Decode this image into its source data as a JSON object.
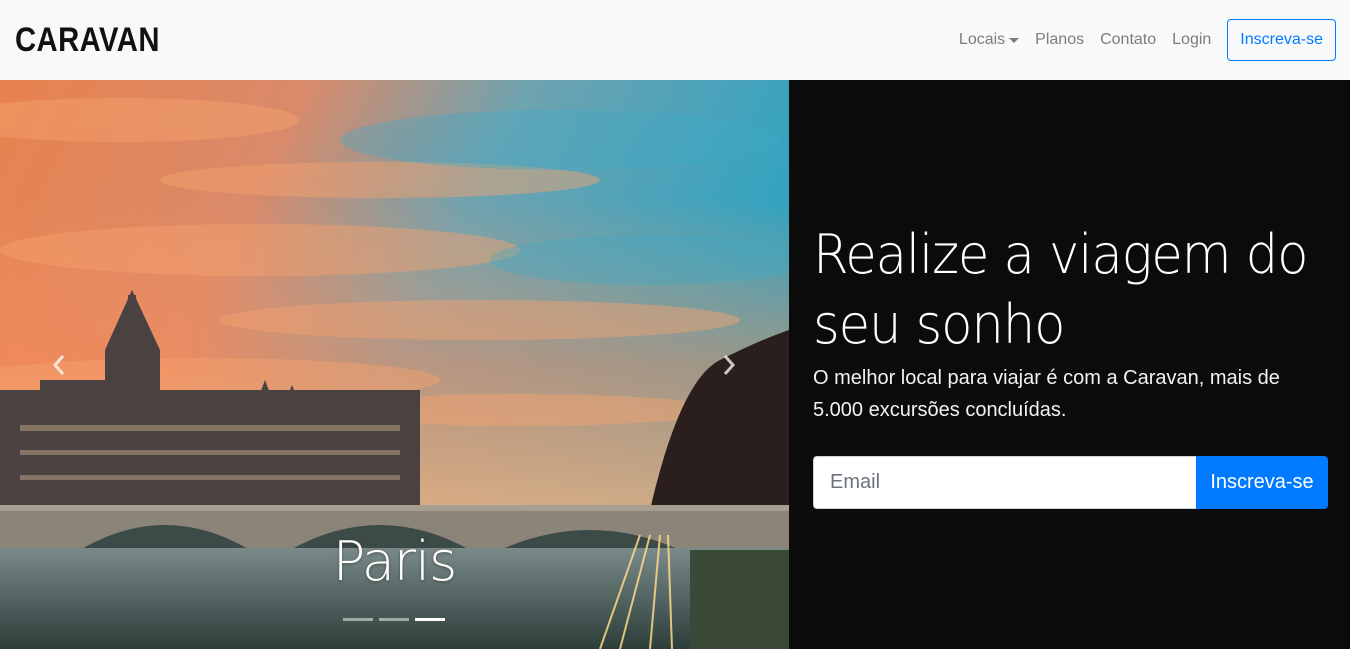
{
  "navbar": {
    "brand": "CARAVAN",
    "links": {
      "locais": "Locais",
      "planos": "Planos",
      "contato": "Contato",
      "login": "Login"
    },
    "signup_label": "Inscreva-se"
  },
  "carousel": {
    "caption": "Paris",
    "slide_count": 3,
    "active_index": 2,
    "prev_icon": "chevron-left-icon",
    "next_icon": "chevron-right-icon"
  },
  "hero": {
    "title": "Realize a viagem do seu sonho",
    "subtitle": "O melhor local para viajar é com a Caravan, mais de 5.000 excursões concluídas.",
    "email_placeholder": "Email",
    "email_value": "",
    "signup_label": "Inscreva-se"
  },
  "colors": {
    "primary": "#007bff",
    "navbar_bg": "#f8f9fa",
    "hero_bg": "#0b0b0b"
  }
}
